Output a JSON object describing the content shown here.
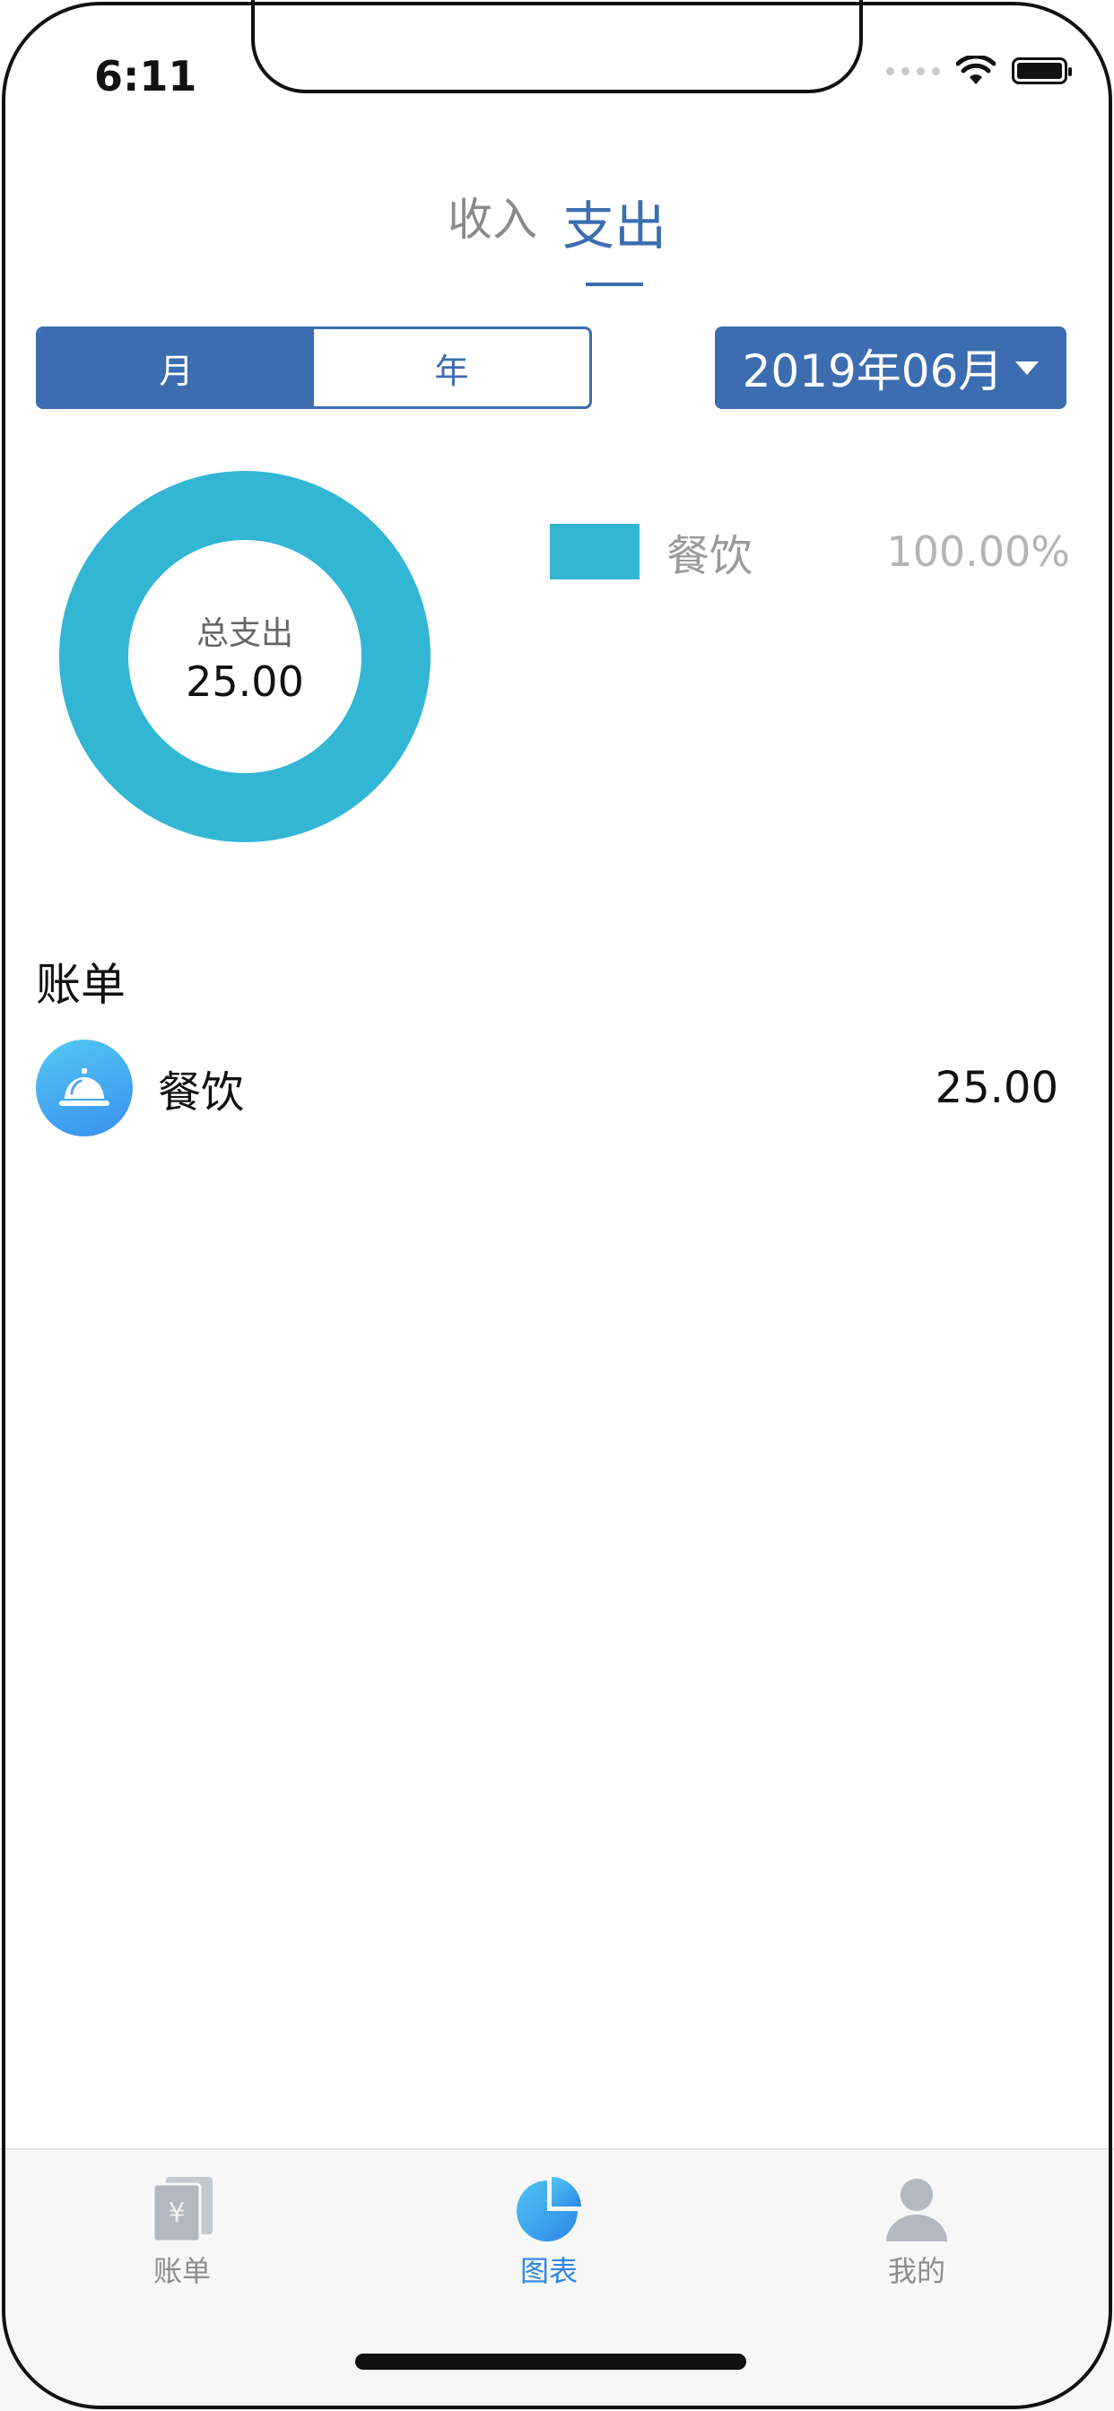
{
  "status_bar": {
    "time": "6:11"
  },
  "type_tabs": [
    {
      "label": "收入",
      "active": false
    },
    {
      "label": "支出",
      "active": true
    }
  ],
  "period_toggle": [
    {
      "label": "月",
      "active": true
    },
    {
      "label": "年",
      "active": false
    }
  ],
  "date_selector": {
    "label": "2019年06月"
  },
  "chart_data": {
    "type": "pie",
    "donut": true,
    "center_label": "总支出",
    "center_value": "25.00",
    "slices": [
      {
        "name": "餐饮",
        "value": 25.0,
        "percent_label": "100.00%",
        "color": "#32b6d4"
      }
    ]
  },
  "bills": {
    "title": "账单",
    "items": [
      {
        "name": "餐饮",
        "amount": "25.00",
        "icon": "service-bell-icon"
      }
    ]
  },
  "tab_bar": [
    {
      "label": "账单",
      "icon": "bill-icon",
      "active": false
    },
    {
      "label": "图表",
      "icon": "pie-chart-icon",
      "active": true
    },
    {
      "label": "我的",
      "icon": "user-icon",
      "active": false
    }
  ],
  "colors": {
    "accent": "#3c6db0",
    "slice": "#32b6d4",
    "tab_active": "#2e86ea"
  }
}
